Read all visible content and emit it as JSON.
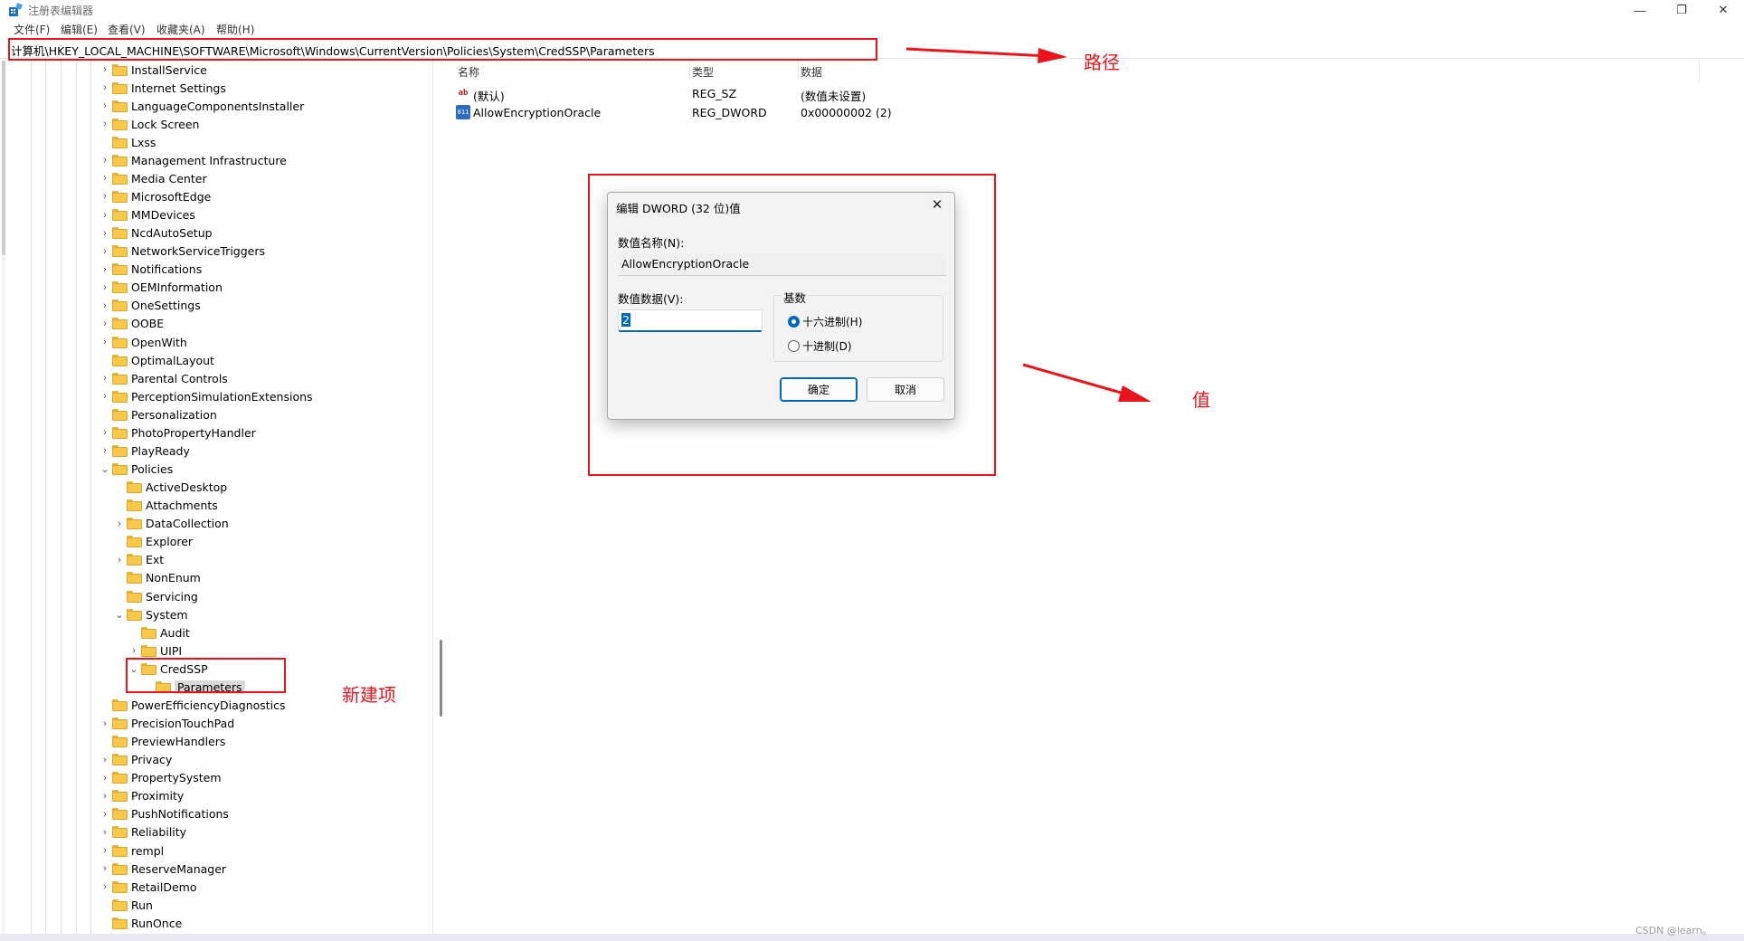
{
  "window": {
    "title": "注册表编辑器",
    "controls": {
      "minimize": "—",
      "maximize": "❐",
      "close": "✕"
    }
  },
  "menu": [
    "文件(F)",
    "编辑(E)",
    "查看(V)",
    "收藏夹(A)",
    "帮助(H)"
  ],
  "address": "计算机\\HKEY_LOCAL_MACHINE\\SOFTWARE\\Microsoft\\Windows\\CurrentVersion\\Policies\\System\\CredSSP\\Parameters",
  "tree": [
    {
      "label": "InstallService",
      "level": 0,
      "chevron": "›"
    },
    {
      "label": "Internet Settings",
      "level": 0,
      "chevron": "›"
    },
    {
      "label": "LanguageComponentsInstaller",
      "level": 0,
      "chevron": "›"
    },
    {
      "label": "Lock Screen",
      "level": 0,
      "chevron": "›"
    },
    {
      "label": "Lxss",
      "level": 0,
      "chevron": ""
    },
    {
      "label": "Management Infrastructure",
      "level": 0,
      "chevron": "›"
    },
    {
      "label": "Media Center",
      "level": 0,
      "chevron": "›"
    },
    {
      "label": "MicrosoftEdge",
      "level": 0,
      "chevron": "›"
    },
    {
      "label": "MMDevices",
      "level": 0,
      "chevron": "›"
    },
    {
      "label": "NcdAutoSetup",
      "level": 0,
      "chevron": "›"
    },
    {
      "label": "NetworkServiceTriggers",
      "level": 0,
      "chevron": "›"
    },
    {
      "label": "Notifications",
      "level": 0,
      "chevron": "›"
    },
    {
      "label": "OEMInformation",
      "level": 0,
      "chevron": "›"
    },
    {
      "label": "OneSettings",
      "level": 0,
      "chevron": "›"
    },
    {
      "label": "OOBE",
      "level": 0,
      "chevron": "›"
    },
    {
      "label": "OpenWith",
      "level": 0,
      "chevron": "›"
    },
    {
      "label": "OptimalLayout",
      "level": 0,
      "chevron": ""
    },
    {
      "label": "Parental Controls",
      "level": 0,
      "chevron": "›"
    },
    {
      "label": "PerceptionSimulationExtensions",
      "level": 0,
      "chevron": "›"
    },
    {
      "label": "Personalization",
      "level": 0,
      "chevron": ""
    },
    {
      "label": "PhotoPropertyHandler",
      "level": 0,
      "chevron": "›"
    },
    {
      "label": "PlayReady",
      "level": 0,
      "chevron": "›"
    },
    {
      "label": "Policies",
      "level": 0,
      "chevron": "⌄"
    },
    {
      "label": "ActiveDesktop",
      "level": 1,
      "chevron": ""
    },
    {
      "label": "Attachments",
      "level": 1,
      "chevron": ""
    },
    {
      "label": "DataCollection",
      "level": 1,
      "chevron": "›"
    },
    {
      "label": "Explorer",
      "level": 1,
      "chevron": ""
    },
    {
      "label": "Ext",
      "level": 1,
      "chevron": "›"
    },
    {
      "label": "NonEnum",
      "level": 1,
      "chevron": ""
    },
    {
      "label": "Servicing",
      "level": 1,
      "chevron": ""
    },
    {
      "label": "System",
      "level": 1,
      "chevron": "⌄"
    },
    {
      "label": "Audit",
      "level": 2,
      "chevron": ""
    },
    {
      "label": "UIPI",
      "level": 2,
      "chevron": "›"
    },
    {
      "label": "CredSSP",
      "level": 2,
      "chevron": "⌄"
    },
    {
      "label": "Parameters",
      "level": 3,
      "chevron": "",
      "selected": true
    },
    {
      "label": "PowerEfficiencyDiagnostics",
      "level": 0,
      "chevron": ""
    },
    {
      "label": "PrecisionTouchPad",
      "level": 0,
      "chevron": "›"
    },
    {
      "label": "PreviewHandlers",
      "level": 0,
      "chevron": ""
    },
    {
      "label": "Privacy",
      "level": 0,
      "chevron": "›"
    },
    {
      "label": "PropertySystem",
      "level": 0,
      "chevron": "›"
    },
    {
      "label": "Proximity",
      "level": 0,
      "chevron": "›"
    },
    {
      "label": "PushNotifications",
      "level": 0,
      "chevron": "›"
    },
    {
      "label": "Reliability",
      "level": 0,
      "chevron": "›"
    },
    {
      "label": "rempl",
      "level": 0,
      "chevron": "›"
    },
    {
      "label": "ReserveManager",
      "level": 0,
      "chevron": "›"
    },
    {
      "label": "RetailDemo",
      "level": 0,
      "chevron": "›"
    },
    {
      "label": "Run",
      "level": 0,
      "chevron": ""
    },
    {
      "label": "RunOnce",
      "level": 0,
      "chevron": ""
    }
  ],
  "list": {
    "columns": [
      "名称",
      "类型",
      "数据"
    ],
    "rows": [
      {
        "icon": "string-value-icon",
        "glyph": "ab",
        "name": "(默认)",
        "type": "REG_SZ",
        "data": "(数值未设置)"
      },
      {
        "icon": "dword-value-icon",
        "glyph": "011",
        "name": "AllowEncryptionOracle",
        "type": "REG_DWORD",
        "data": "0x00000002 (2)"
      }
    ]
  },
  "dialog": {
    "title": "编辑 DWORD (32 位)值",
    "close": "✕",
    "name_label": "数值名称(N):",
    "name_value": "AllowEncryptionOracle",
    "data_label": "数值数据(V):",
    "data_value": "2",
    "base_label": "基数",
    "radio_hex": "十六进制(H)",
    "radio_dec": "十进制(D)",
    "selected_base": "hex",
    "ok": "确定",
    "cancel": "取消"
  },
  "annotations": {
    "path": "路径",
    "value": "值",
    "new_item": "新建项",
    "color": "#e8161c"
  },
  "watermark": "CSDN @learn。"
}
